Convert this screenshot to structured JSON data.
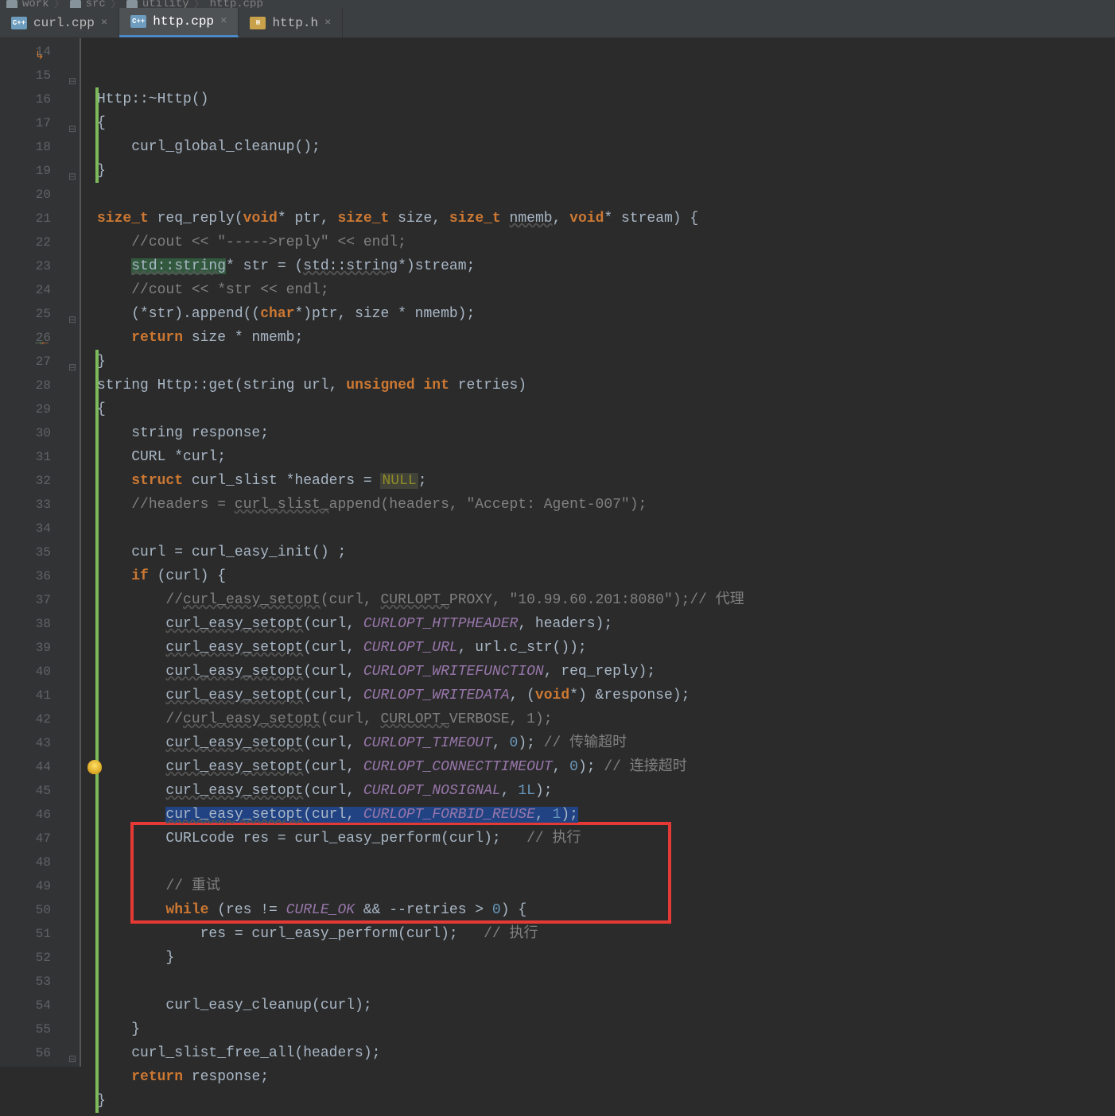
{
  "breadcrumbs": [
    "work",
    "src",
    "utility",
    "http.cpp"
  ],
  "tabs": [
    {
      "label": "curl.cpp",
      "type": "cpp",
      "active": false
    },
    {
      "label": "http.cpp",
      "type": "cpp",
      "active": true
    },
    {
      "label": "http.h",
      "type": "h",
      "active": false
    }
  ],
  "lines": {
    "start": 14,
    "end": 56
  },
  "code": [
    {
      "n": 14,
      "marker": "↳",
      "html": "Http::~Http()"
    },
    {
      "n": 15,
      "fold": "⊟",
      "html": "{"
    },
    {
      "n": 16,
      "html": "    curl_global_cleanup();"
    },
    {
      "n": 17,
      "fold": "⊟",
      "html": "}"
    },
    {
      "n": 18,
      "html": ""
    },
    {
      "n": 19,
      "fold": "⊟",
      "html": "<span class='kw'>size_t</span> req_reply(<span class='kw'>void</span>* ptr, <span class='kw'>size_t</span> size, <span class='kw'>size_t</span> <span class='underline'>nmemb</span>, <span class='kw'>void</span>* stream) {"
    },
    {
      "n": 20,
      "html": "    <span class='cmt'>//cout &lt;&lt; \"-----&gt;reply\" &lt;&lt; endl;</span>"
    },
    {
      "n": 21,
      "html": "    <span class='underline' style='background:#32593d'>std::string</span>* str = (<span class='underline'>std::string</span>*)stream;"
    },
    {
      "n": 22,
      "html": "    <span class='cmt'>//cout &lt;&lt; *str &lt;&lt; endl;</span>"
    },
    {
      "n": 23,
      "html": "    (*str).append((<span class='kw'>char</span>*)ptr, size * nmemb);"
    },
    {
      "n": 24,
      "html": "    <span class='kw'>return</span> size * nmemb;"
    },
    {
      "n": 25,
      "fold": "⊟",
      "html": "}"
    },
    {
      "n": 26,
      "marker": "⇆",
      "html": "string Http::get(string url, <span class='kw'>unsigned int</span> retries)"
    },
    {
      "n": 27,
      "fold": "⊟",
      "html": "{"
    },
    {
      "n": 28,
      "html": "    string response;"
    },
    {
      "n": 29,
      "html": "    CURL *curl;"
    },
    {
      "n": 30,
      "html": "    <span class='kw'>struct</span> curl_slist *headers = <span class='macro null-bg'>NULL</span>;"
    },
    {
      "n": 31,
      "html": "    <span class='cmt'>//headers = <span class='underline'>curl_slist_</span>append(headers, \"Accept: Agent-007\");</span>"
    },
    {
      "n": 32,
      "html": ""
    },
    {
      "n": 33,
      "html": "    curl = curl_easy_init() ;"
    },
    {
      "n": 34,
      "html": "    <span class='kw'>if</span> (curl) {"
    },
    {
      "n": 35,
      "html": "        <span class='cmt'>//<span class='underline'>curl_easy_setopt</span>(curl, <span class='underline'>CURLOPT_</span>PROXY, \"10.99.60.201:8080\");// 代理</span>"
    },
    {
      "n": 36,
      "html": "        <span class='underline'>curl_easy_setopt</span>(curl, <span class='const'>CURLOPT_HTTPHEADER</span>, headers);"
    },
    {
      "n": 37,
      "html": "        <span class='underline'>curl_easy_setopt</span>(curl, <span class='const'>CURLOPT_URL</span>, url.c_str());"
    },
    {
      "n": 38,
      "html": "        <span class='underline'>curl_easy_setopt</span>(curl, <span class='const'>CURLOPT_WRITEFUNCTION</span>, req_reply);"
    },
    {
      "n": 39,
      "html": "        <span class='underline'>curl_easy_setopt</span>(curl, <span class='const'>CURLOPT_WRITEDATA</span>, (<span class='kw'>void</span>*) &amp;response);"
    },
    {
      "n": 40,
      "html": "        <span class='cmt'>//<span class='underline'>curl_easy_setopt</span>(curl, <span class='underline'>CURLOPT_</span>VERBOSE, 1);</span>"
    },
    {
      "n": 41,
      "html": "        <span class='underline'>curl_easy_setopt</span>(curl, <span class='const'>CURLOPT_TIMEOUT</span>, <span class='num'>0</span>); <span class='cmt'>// 传输超时</span>"
    },
    {
      "n": 42,
      "html": "        <span class='underline'>curl_easy_setopt</span>(curl, <span class='const'>CURLOPT_CONNECTTIMEOUT</span>, <span class='num'>0</span>); <span class='cmt'>// 连接超时</span>"
    },
    {
      "n": 43,
      "html": "        <span class='underline'>curl_easy_setopt</span>(curl, <span class='const'>CURLOPT_NOSIGNAL</span>, <span class='num'>1L</span>);"
    },
    {
      "n": 44,
      "bulb": true,
      "html": "        <span class='sel-bg'><span class='underline'>curl_easy_setopt</span>(curl, <span class='const'>CURLOPT_FORBID_REUSE</span>, <span class='num'>1</span>);</span>"
    },
    {
      "n": 45,
      "html": "        CURLcode res = curl_easy_perform(curl);   <span class='cmt'>// 执行</span>"
    },
    {
      "n": 46,
      "html": ""
    },
    {
      "n": 47,
      "html": "        <span class='cmt'>// 重试</span>"
    },
    {
      "n": 48,
      "html": "        <span class='kw'>while</span> (res != <span class='const'>CURLE_OK</span> &amp;&amp; --retries &gt; <span class='num'>0</span>) {"
    },
    {
      "n": 49,
      "html": "            res = curl_easy_perform(curl);   <span class='cmt'>// 执行</span>"
    },
    {
      "n": 50,
      "html": "        }"
    },
    {
      "n": 51,
      "html": ""
    },
    {
      "n": 52,
      "html": "        curl_easy_cleanup(curl);"
    },
    {
      "n": 53,
      "html": "    }"
    },
    {
      "n": 54,
      "html": "    curl_slist_free_all(headers);"
    },
    {
      "n": 55,
      "html": "    <span class='kw'>return</span> response;"
    },
    {
      "n": 56,
      "fold": "⊟",
      "html": "}"
    }
  ],
  "change_bar_lines": [
    14,
    15,
    16,
    17,
    25,
    26,
    27,
    28,
    29,
    30,
    31,
    32,
    33,
    34,
    35,
    36,
    37,
    38,
    39,
    40,
    41,
    42,
    43,
    44,
    45,
    46,
    47,
    48,
    49,
    50,
    51,
    52,
    53,
    54,
    55,
    56
  ],
  "highlight_box": {
    "from_line": 47,
    "to_line": 50
  }
}
